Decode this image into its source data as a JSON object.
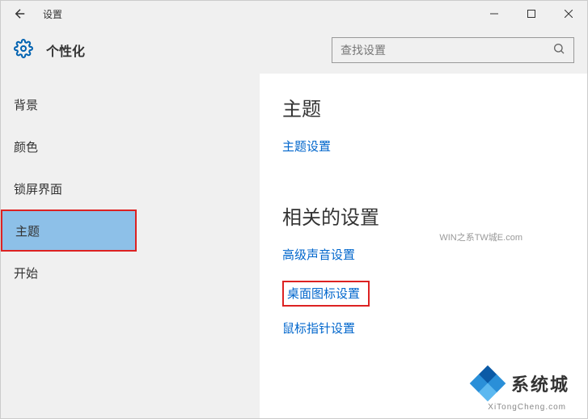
{
  "window": {
    "title": "设置"
  },
  "header": {
    "category": "个性化"
  },
  "search": {
    "placeholder": "查找设置"
  },
  "sidebar": {
    "items": [
      {
        "label": "背景"
      },
      {
        "label": "颜色"
      },
      {
        "label": "锁屏界面"
      },
      {
        "label": "主题"
      },
      {
        "label": "开始"
      }
    ]
  },
  "main": {
    "section1_title": "主题",
    "theme_settings_link": "主题设置",
    "section2_title": "相关的设置",
    "adv_sound_link": "高级声音设置",
    "desktop_icon_link": "桌面图标设置",
    "mouse_pointer_link": "鼠标指针设置"
  },
  "watermark": {
    "brand": "系统城",
    "sub": "XiTongCheng.com",
    "faint": "WIN之系TW城E.com"
  }
}
